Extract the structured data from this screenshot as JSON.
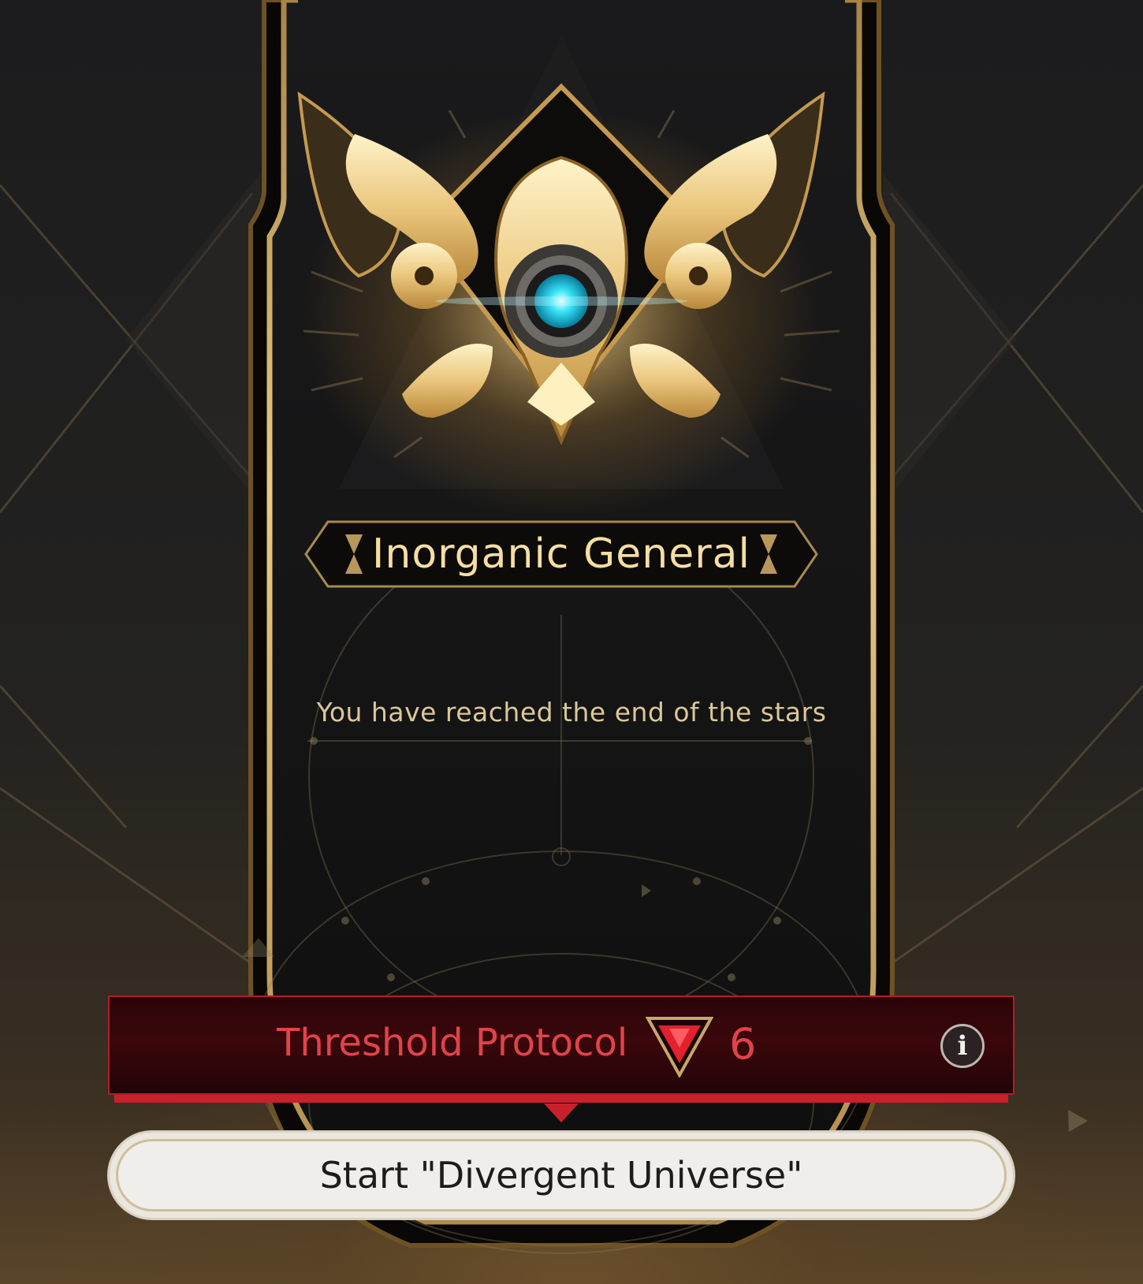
{
  "rank": {
    "title": "Inorganic General",
    "subtitle": "You have reached the end of the stars",
    "emblem_icon": "gold-winged-gear-emblem",
    "accent_color": "#f6dea2"
  },
  "threshold": {
    "label": "Threshold Protocol",
    "level": "6",
    "level_icon": "red-inverted-triangle",
    "color": "#e0434b",
    "info_icon": "i"
  },
  "start_button": {
    "label": "Start \"Divergent Universe\""
  }
}
